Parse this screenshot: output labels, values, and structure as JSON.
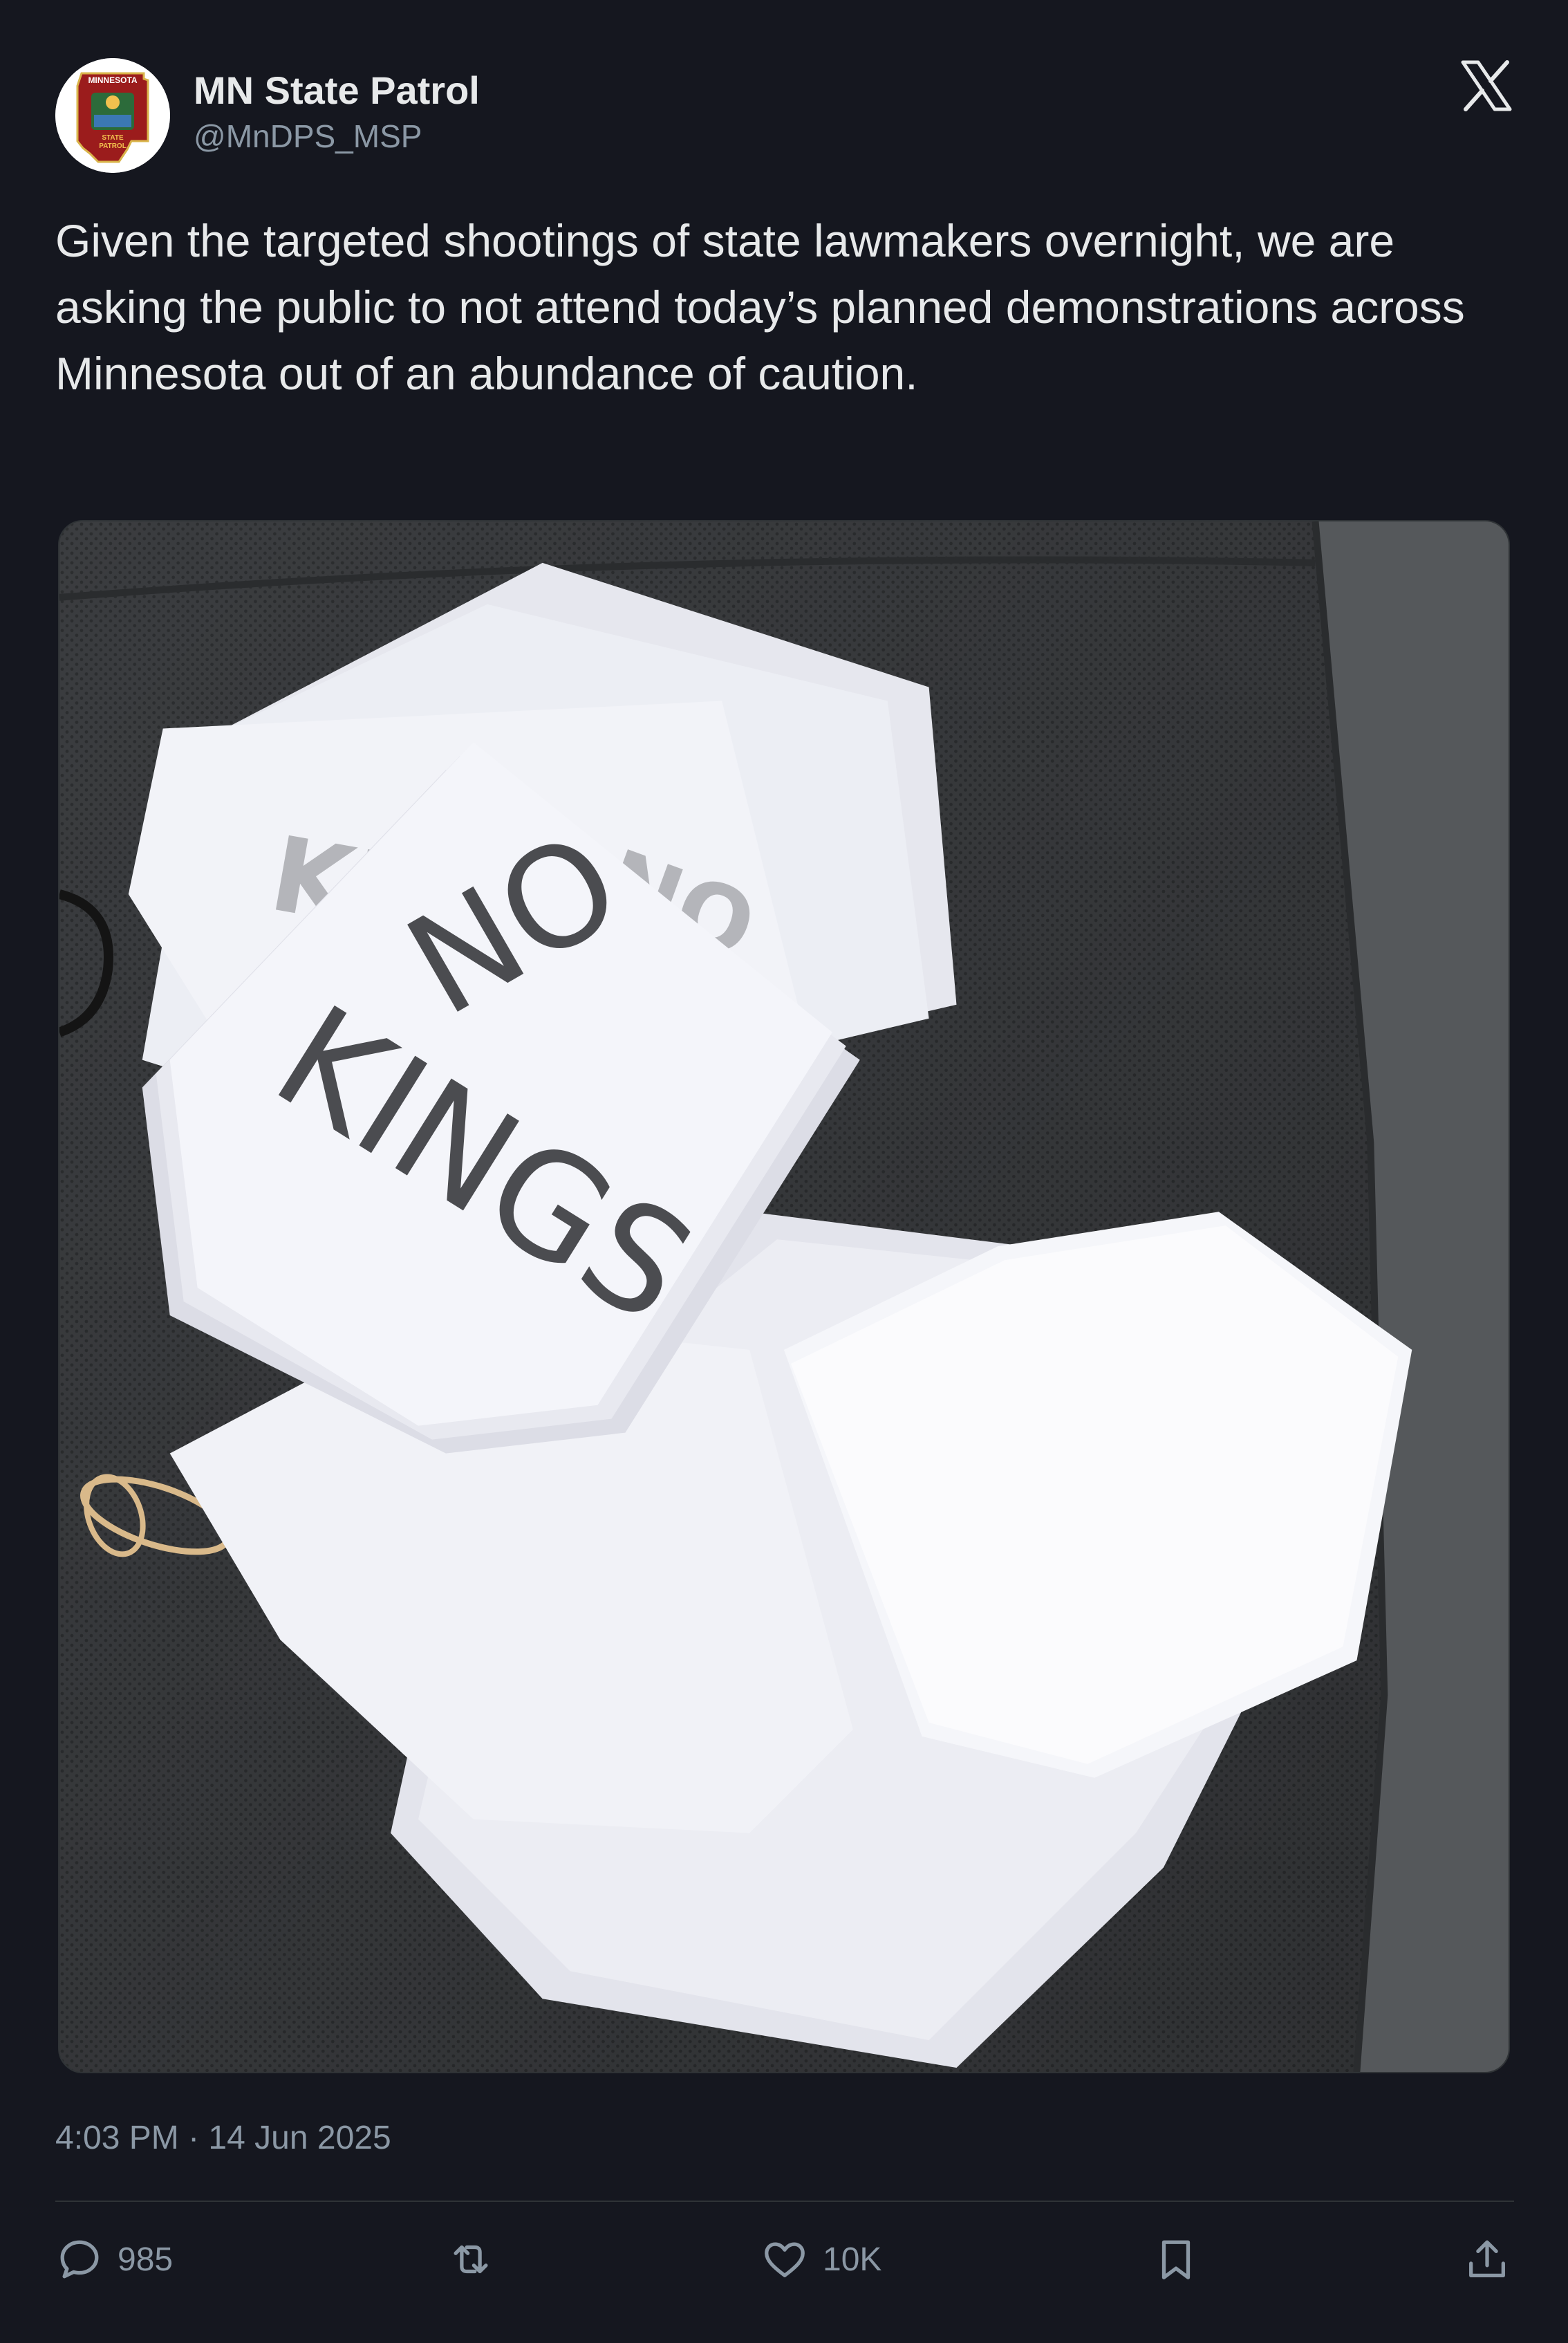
{
  "account": {
    "display_name": "MN State Patrol",
    "handle": "@MnDPS_MSP",
    "avatar_text_top": "MINNESOTA",
    "avatar_text_mid": "STATE",
    "avatar_text_bottom": "PATROL"
  },
  "tweet": {
    "text": "Given the targeted shootings of state lawmakers overnight, we are asking the public to not attend today’s planned demonstrations across Minnesota out of an abundance of caution.",
    "timestamp": "4:03 PM · 14 Jun 2025"
  },
  "media": {
    "sign_line_1": "NO",
    "sign_line_2": "KINGS"
  },
  "actions": {
    "replies": "985",
    "reposts": "",
    "likes": "10K"
  },
  "icons": {
    "platform": "x-logo-icon",
    "reply": "reply-icon",
    "repost": "repost-icon",
    "like": "heart-icon",
    "bookmark": "bookmark-icon",
    "share": "share-icon"
  },
  "colors": {
    "background": "#15171f",
    "text_primary": "#e7e9ea",
    "text_secondary": "#8b98a5",
    "divider": "#2f3336",
    "patch_red": "#9b1c1c"
  }
}
